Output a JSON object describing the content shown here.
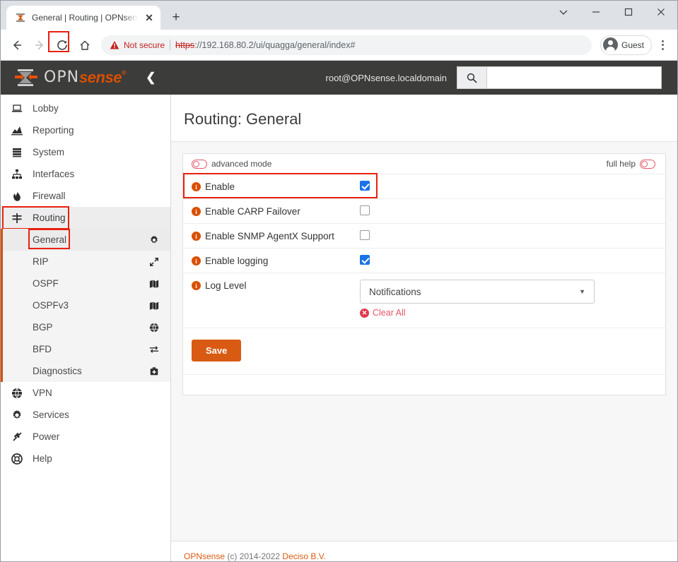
{
  "browser": {
    "tab": {
      "title": "General | Routing | OPNsense.loc",
      "favicon_icon": "opnsense-favicon",
      "close_icon": "close-icon"
    },
    "new_tab_icon": "plus-icon",
    "window_controls": [
      {
        "name": "tab-search",
        "icon": "chevron-down-icon",
        "glyph": "⌄"
      },
      {
        "name": "minimize",
        "icon": "minimize-icon",
        "glyph": "—"
      },
      {
        "name": "maximize",
        "icon": "maximize-icon",
        "glyph": "□"
      },
      {
        "name": "close",
        "icon": "close-icon",
        "glyph": "✕"
      }
    ],
    "toolbar": {
      "back_icon": "back-arrow-icon",
      "forward_icon": "forward-arrow-icon",
      "reload_icon": "reload-icon",
      "home_icon": "home-icon",
      "security_label": "Not secure",
      "warning_icon": "warning-triangle-icon",
      "url_scheme": "https",
      "url_rest": "://192.168.80.2/ui/quagga/general/index#",
      "profile_name": "Guest",
      "profile_icon": "account-avatar-icon",
      "menu_icon": "kebab-menu-icon"
    },
    "highlight_color": "#e8200f"
  },
  "app": {
    "logo": {
      "opn": "OPN",
      "sense": "sense",
      "registered": "®",
      "mark_icon": "opnsense-logo-icon"
    },
    "collapse_icon": "chevron-left-icon",
    "user": "root@OPNsense.localdomain",
    "search": {
      "icon": "search-icon",
      "value": "",
      "placeholder": ""
    },
    "brand_color": "#d94f00",
    "header_bg": "#3c3c3b"
  },
  "sidebar": {
    "items": [
      {
        "label": "Lobby",
        "icon": "laptop-icon",
        "glyph": "⌸"
      },
      {
        "label": "Reporting",
        "icon": "chart-area-icon",
        "glyph": "◢"
      },
      {
        "label": "System",
        "icon": "server-list-icon",
        "glyph": "☰"
      },
      {
        "label": "Interfaces",
        "icon": "sitemap-icon",
        "glyph": "⑂"
      },
      {
        "label": "Firewall",
        "icon": "fire-icon",
        "glyph": "♨"
      },
      {
        "label": "Routing",
        "icon": "signpost-icon",
        "glyph": "☩",
        "active": true,
        "highlighted": true
      },
      {
        "label": "VPN",
        "icon": "globe-icon",
        "glyph": "ἱ0"
      },
      {
        "label": "Services",
        "icon": "gear-icon",
        "glyph": "⚙"
      },
      {
        "label": "Power",
        "icon": "power-plug-icon",
        "glyph": "⚡"
      },
      {
        "label": "Help",
        "icon": "lifebuoy-icon",
        "glyph": "❁"
      }
    ],
    "submenu": [
      {
        "label": "General",
        "icon": "gear-icon",
        "current": true,
        "highlighted": true
      },
      {
        "label": "RIP",
        "icon": "expand-arrows-icon"
      },
      {
        "label": "OSPF",
        "icon": "map-icon"
      },
      {
        "label": "OSPFv3",
        "icon": "map-icon"
      },
      {
        "label": "BGP",
        "icon": "globe-icon"
      },
      {
        "label": "BFD",
        "icon": "exchange-arrows-icon"
      },
      {
        "label": "Diagnostics",
        "icon": "first-aid-kit-icon"
      }
    ]
  },
  "page": {
    "title": "Routing: General",
    "panel_head": {
      "advanced_mode_label": "advanced mode",
      "advanced_mode_state": "off",
      "full_help_label": "full help",
      "full_help_state": "off",
      "toggle_icon": "toggle-off-icon"
    },
    "rows": [
      {
        "label": "Enable",
        "type": "checkbox",
        "checked": true,
        "info_icon": "info-icon",
        "highlighted": true
      },
      {
        "label": "Enable CARP Failover",
        "type": "checkbox",
        "checked": false,
        "info_icon": "info-icon"
      },
      {
        "label": "Enable SNMP AgentX Support",
        "type": "checkbox",
        "checked": false,
        "info_icon": "info-icon"
      },
      {
        "label": "Enable logging",
        "type": "checkbox",
        "checked": true,
        "info_icon": "info-icon"
      },
      {
        "label": "Log Level",
        "type": "select",
        "value": "Notifications",
        "info_icon": "info-icon",
        "caret_icon": "caret-down-icon",
        "clear_all_label": "Clear All",
        "clear_all_icon": "times-circle-icon"
      }
    ],
    "save_label": "Save",
    "save_highlighted": true
  },
  "footer": {
    "brand": "OPNsense",
    "copyright": " (c) 2014-2022 ",
    "company": "Deciso B.V."
  }
}
